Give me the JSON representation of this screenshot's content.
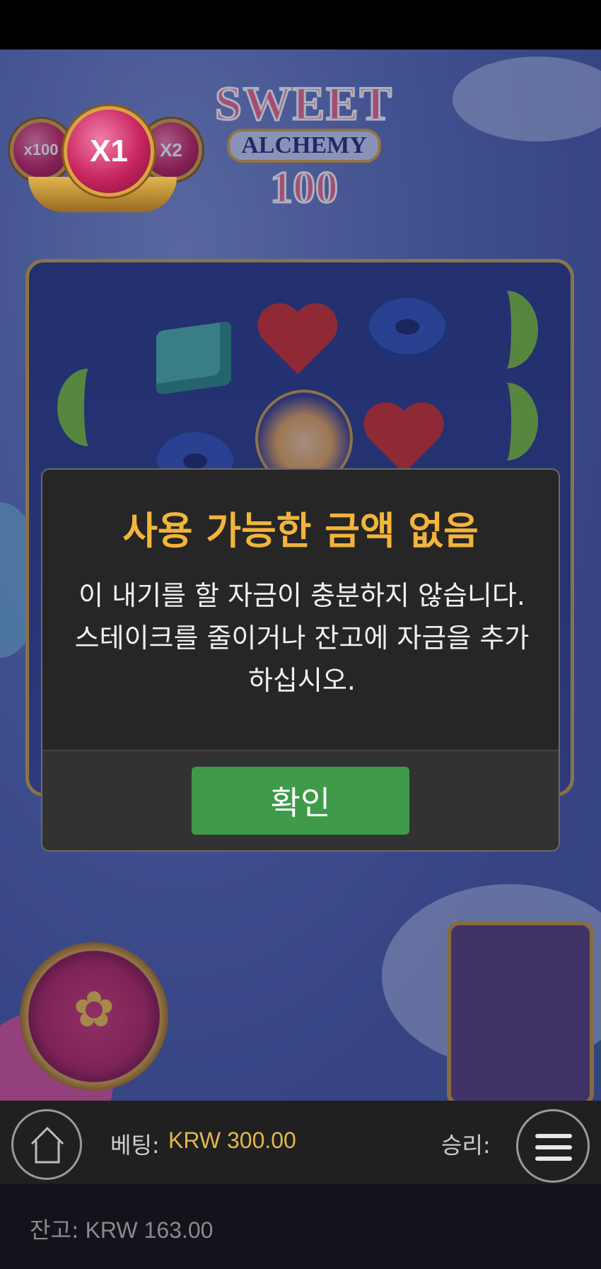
{
  "game": {
    "logo_line1": "SWEET",
    "logo_line2": "ALCHEMY",
    "logo_line3": "100",
    "multipliers": {
      "left": "x100",
      "main": "X1",
      "right": "X2"
    }
  },
  "dialog": {
    "title": "사용 가능한 금액 없음",
    "message": "이 내기를 할 자금이 충분하지 않습니다. 스테이크를 줄이거나 잔고에 자금을 추가하십시오.",
    "confirm_label": "확인"
  },
  "bottom_bar": {
    "bet_label": "베팅:",
    "bet_value": "KRW 300.00",
    "win_label": "승리:"
  },
  "footer": {
    "balance_label": "잔고:",
    "balance_value": "KRW 163.00"
  },
  "colors": {
    "accent_gold": "#f2b43a",
    "confirm_green": "#3f9a4a"
  },
  "icons": [
    "home-icon",
    "menu-icon",
    "star-icon"
  ]
}
